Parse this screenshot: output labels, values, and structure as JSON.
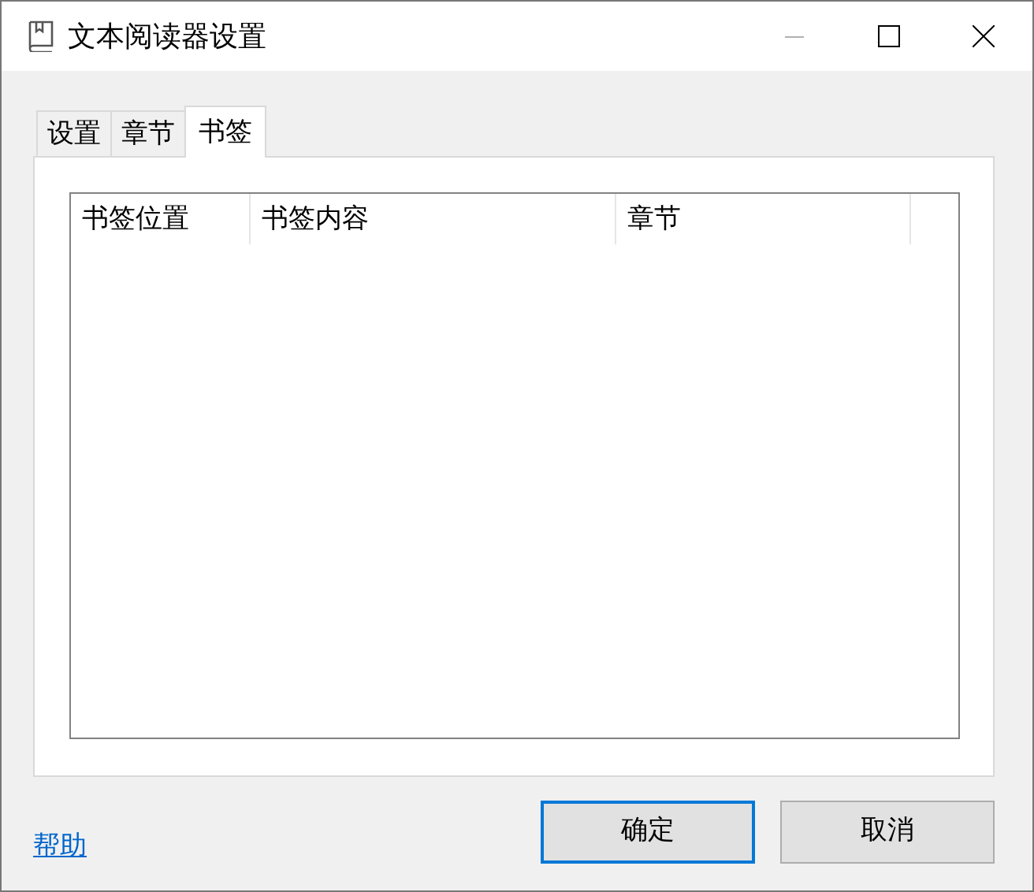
{
  "window": {
    "title": "文本阅读器设置",
    "minimize_disabled": true
  },
  "tabs": [
    {
      "label": "设置",
      "selected": false
    },
    {
      "label": "章节",
      "selected": false
    },
    {
      "label": "书签",
      "selected": true
    }
  ],
  "list": {
    "columns": [
      "书签位置",
      "书签内容",
      "章节"
    ]
  },
  "help_link": "帮助",
  "buttons": [
    {
      "label": "确定",
      "default": true
    },
    {
      "label": "取消",
      "default": false
    }
  ]
}
